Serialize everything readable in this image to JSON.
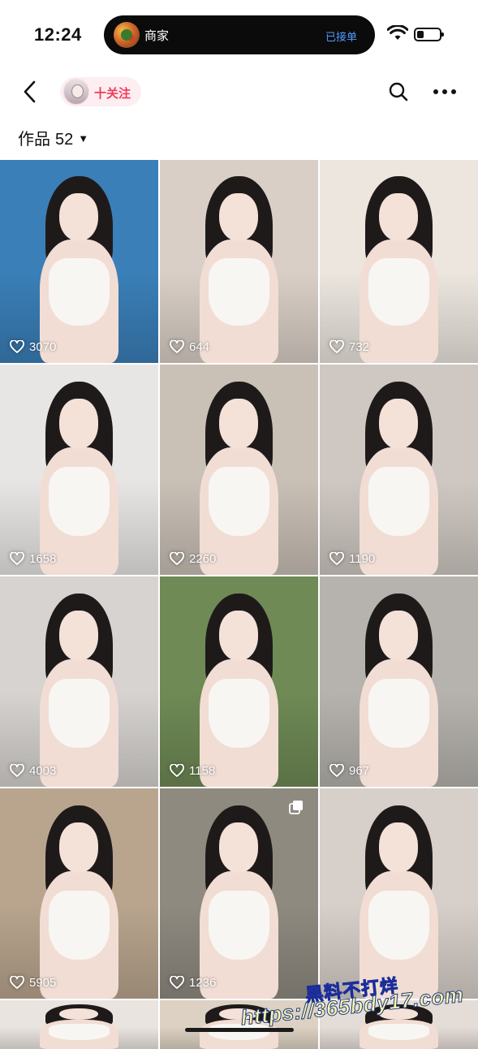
{
  "status_bar": {
    "time": "12:24",
    "island": {
      "app_name": "商家",
      "order_status": "已接单"
    }
  },
  "nav": {
    "follow_label": "十关注"
  },
  "works": {
    "label": "作品",
    "count": "52"
  },
  "grid": {
    "tiles": [
      {
        "likes": "3070",
        "bg": "#3a7fb8"
      },
      {
        "likes": "644",
        "bg": "#d9cfc6"
      },
      {
        "likes": "732",
        "bg": "#ece6df"
      },
      {
        "likes": "1658",
        "bg": "#e8e6e4"
      },
      {
        "likes": "2260",
        "bg": "#c9c0b6"
      },
      {
        "likes": "1190",
        "bg": "#cfc8c2"
      },
      {
        "likes": "4003",
        "bg": "#d6d3d0"
      },
      {
        "likes": "1158",
        "bg": "#6f8a55"
      },
      {
        "likes": "967",
        "bg": "#b6b3ae"
      },
      {
        "likes": "5905",
        "bg": "#b9a58e"
      },
      {
        "likes": "1236",
        "bg": "#8f8a80"
      },
      {
        "likes": "",
        "bg": "#d7cfc9"
      },
      {
        "likes": "",
        "bg": "#e9e4df"
      },
      {
        "likes": "",
        "bg": "#dcd1c2"
      },
      {
        "likes": "",
        "bg": "#e4dcd7"
      }
    ]
  },
  "watermark": {
    "line1": "黑料不打烊",
    "line2": "https://365bdy17.com"
  },
  "colors": {
    "accent": "#f23a59",
    "chip_bg": "#fdeef1",
    "island_link": "#4f9bff"
  }
}
